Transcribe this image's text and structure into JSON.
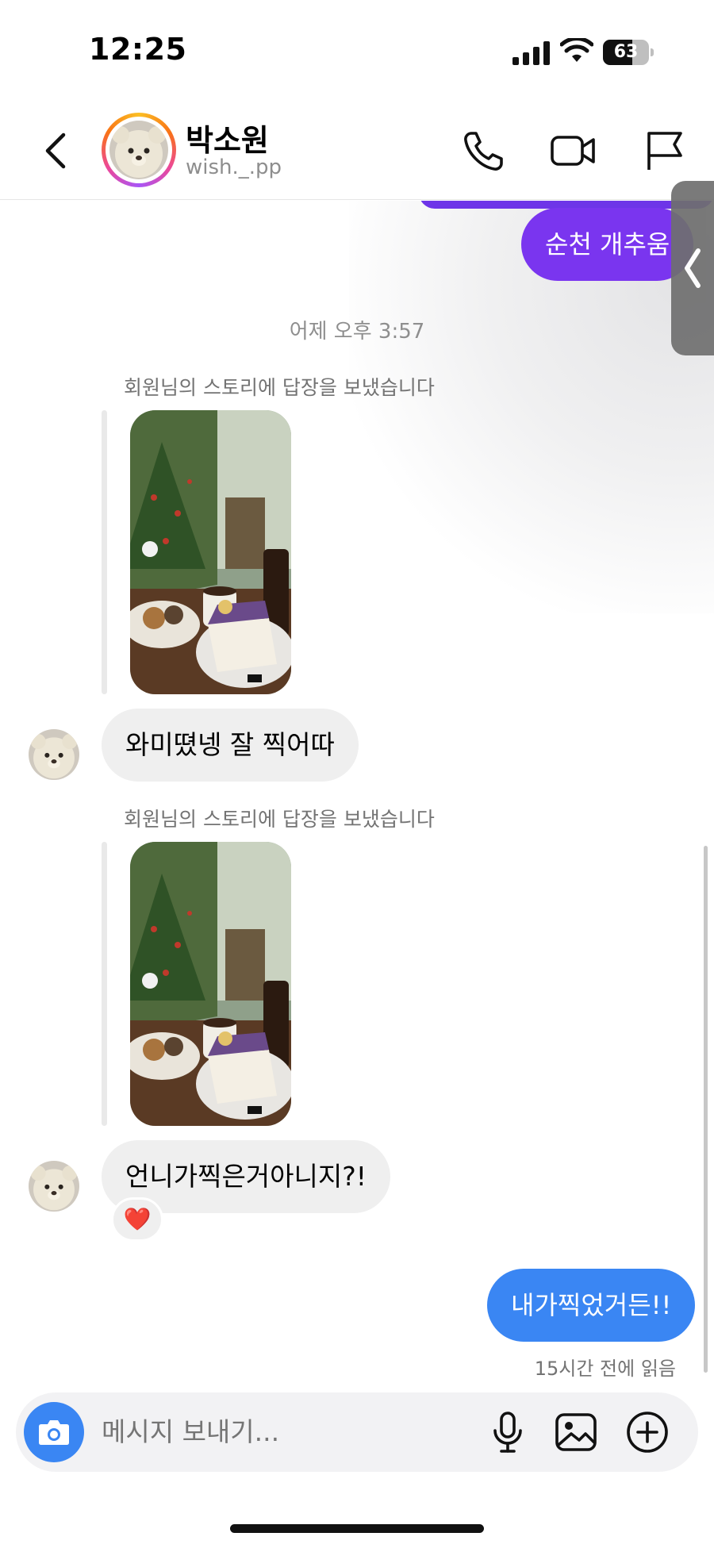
{
  "status_bar": {
    "time": "12:25",
    "battery": "63",
    "battery_level": 0.63
  },
  "header": {
    "name": "박소원",
    "username": "wish._.pp",
    "icons": [
      "back-chevron-icon",
      "phone-icon",
      "video-camera-icon",
      "flag-icon"
    ]
  },
  "messages": {
    "prev_outgoing": "순천 개추움",
    "timestamp": "어제 오후 3:57",
    "story_reply_label_1": "회원님의 스토리에 답장을 보냈습니다",
    "incoming_1": "와미뗬넹 잘 찍어따",
    "story_reply_label_2": "회원님의 스토리에 답장을 보냈습니다",
    "incoming_2": "언니가찍은거아니지?!",
    "reaction_2": "❤️",
    "outgoing_last": "내가찍었거든!!",
    "read_receipt": "15시간 전에 읽음"
  },
  "composer": {
    "placeholder": "메시지 보내기...",
    "icons": [
      "camera-icon",
      "microphone-icon",
      "image-icon",
      "plus-circle-icon"
    ]
  },
  "colors": {
    "purple_bubble": "#7a35ef",
    "blue_bubble": "#3a86f3",
    "incoming_bubble": "#efefef",
    "muted_text": "#8e8e8e"
  }
}
